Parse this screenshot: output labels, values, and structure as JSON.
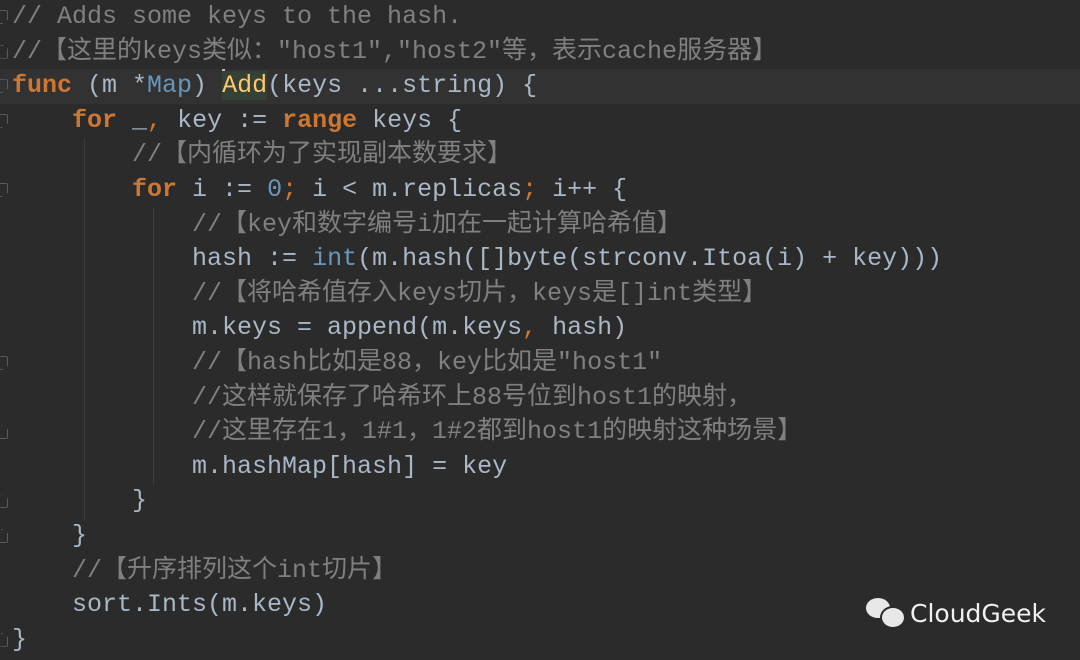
{
  "editor": {
    "language": "go",
    "lines": [
      {
        "fold": "open",
        "parts": [
          {
            "t": "cm",
            "v": "// Adds some keys to the hash."
          }
        ]
      },
      {
        "fold": "close",
        "parts": [
          {
            "t": "cm",
            "v": "//【这里的keys类似：\"host1\",\"host2\"等，表示cache服务器】"
          }
        ]
      },
      {
        "fold": "open",
        "current": true,
        "parts": [
          {
            "t": "kw",
            "v": "func"
          },
          {
            "t": "tx",
            "v": " (m *"
          },
          {
            "t": "ty",
            "v": "Map"
          },
          {
            "t": "tx",
            "v": ") "
          },
          {
            "t": "cursor",
            "v": ""
          },
          {
            "t": "fn",
            "v": "Add"
          },
          {
            "t": "tx",
            "v": "(keys ...string) {"
          }
        ]
      },
      {
        "fold": "open",
        "parts": [
          {
            "t": "tx",
            "v": "    "
          },
          {
            "t": "kw",
            "v": "for"
          },
          {
            "t": "tx",
            "v": " _"
          },
          {
            "t": "semi",
            "v": ","
          },
          {
            "t": "tx",
            "v": " key := "
          },
          {
            "t": "kw",
            "v": "range"
          },
          {
            "t": "tx",
            "v": " keys {"
          }
        ]
      },
      {
        "parts": [
          {
            "t": "tx",
            "v": "        "
          },
          {
            "t": "cm",
            "v": "//【内循环为了实现副本数要求】"
          }
        ]
      },
      {
        "fold": "open",
        "parts": [
          {
            "t": "tx",
            "v": "        "
          },
          {
            "t": "kw",
            "v": "for"
          },
          {
            "t": "tx",
            "v": " i := "
          },
          {
            "t": "num",
            "v": "0"
          },
          {
            "t": "semi",
            "v": ";"
          },
          {
            "t": "tx",
            "v": " i < m.replicas"
          },
          {
            "t": "semi",
            "v": ";"
          },
          {
            "t": "tx",
            "v": " i++ {"
          }
        ]
      },
      {
        "parts": [
          {
            "t": "tx",
            "v": "            "
          },
          {
            "t": "cm",
            "v": "//【key和数字编号i加在一起计算哈希值】"
          }
        ]
      },
      {
        "parts": [
          {
            "t": "tx",
            "v": "            hash := "
          },
          {
            "t": "ty",
            "v": "int"
          },
          {
            "t": "tx",
            "v": "(m.hash([]byte(strconv.Itoa(i) + key)))"
          }
        ]
      },
      {
        "parts": [
          {
            "t": "tx",
            "v": "            "
          },
          {
            "t": "cm",
            "v": "//【将哈希值存入keys切片，keys是[]int类型】"
          }
        ]
      },
      {
        "parts": [
          {
            "t": "tx",
            "v": "            m.keys = append(m.keys"
          },
          {
            "t": "semi",
            "v": ","
          },
          {
            "t": "tx",
            "v": " hash)"
          }
        ]
      },
      {
        "fold": "open",
        "parts": [
          {
            "t": "tx",
            "v": "            "
          },
          {
            "t": "cm",
            "v": "//【hash比如是88，key比如是\"host1\""
          }
        ]
      },
      {
        "parts": [
          {
            "t": "tx",
            "v": "            "
          },
          {
            "t": "cm",
            "v": "//这样就保存了哈希环上88号位到host1的映射，"
          }
        ]
      },
      {
        "fold": "close",
        "parts": [
          {
            "t": "tx",
            "v": "            "
          },
          {
            "t": "cm",
            "v": "//这里存在1，1#1，1#2都到host1的映射这种场景】"
          }
        ]
      },
      {
        "parts": [
          {
            "t": "tx",
            "v": "            m.hashMap[hash] = key"
          }
        ]
      },
      {
        "fold": "close",
        "parts": [
          {
            "t": "tx",
            "v": "        }"
          }
        ]
      },
      {
        "fold": "close",
        "parts": [
          {
            "t": "tx",
            "v": "    }"
          }
        ]
      },
      {
        "parts": [
          {
            "t": "tx",
            "v": "    "
          },
          {
            "t": "cm",
            "v": "//【升序排列这个int切片】"
          }
        ]
      },
      {
        "parts": [
          {
            "t": "tx",
            "v": "    sort.Ints(m.keys)"
          }
        ]
      },
      {
        "fold": "close",
        "parts": [
          {
            "t": "tx",
            "v": "}"
          }
        ]
      }
    ]
  },
  "watermark": {
    "icon": "wechat-icon",
    "label": "CloudGeek"
  }
}
